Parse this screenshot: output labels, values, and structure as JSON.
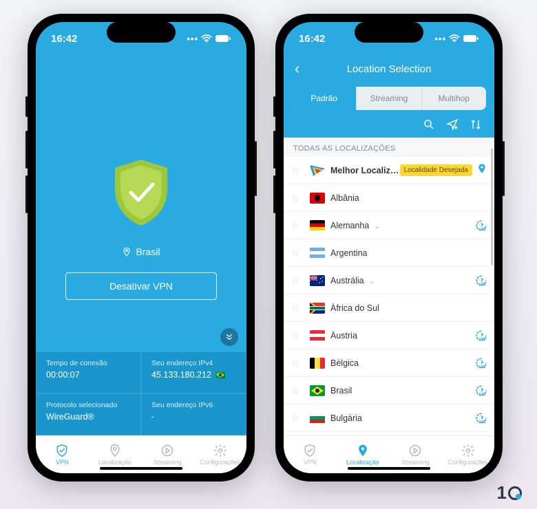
{
  "status": {
    "time": "16:42"
  },
  "phone1": {
    "location": "Brasil",
    "button": "Desativar VPN",
    "cells": {
      "c1_label": "Tempo de conexão",
      "c1_val": "00:00:07",
      "c2_label": "Seu endereço IPv4",
      "c2_val": "45.133.180.212",
      "c3_label": "Protocolo selecionado",
      "c3_val": "WireGuard®",
      "c4_label": "Seu endereço IPv6",
      "c4_val": "-"
    }
  },
  "tabs": {
    "t1": "VPN",
    "t2": "Localização",
    "t3": "Streaming",
    "t4": "Configurações"
  },
  "phone2": {
    "title": "Location Selection",
    "segments": {
      "s1": "Padrão",
      "s2": "Streaming",
      "s3": "Multihop"
    },
    "section": "TODAS AS LOCALIZAÇÕES",
    "best": "Melhor Localiza...",
    "badge": "Localidade Desejada",
    "rows": {
      "r1": "Albânia",
      "r2": "Alemanha",
      "r3": "Argentina",
      "r4": "Austrália",
      "r5": "África do Sul",
      "r6": "Áustria",
      "r7": "Bélgica",
      "r8": "Brasil",
      "r9": "Bulgária"
    }
  }
}
